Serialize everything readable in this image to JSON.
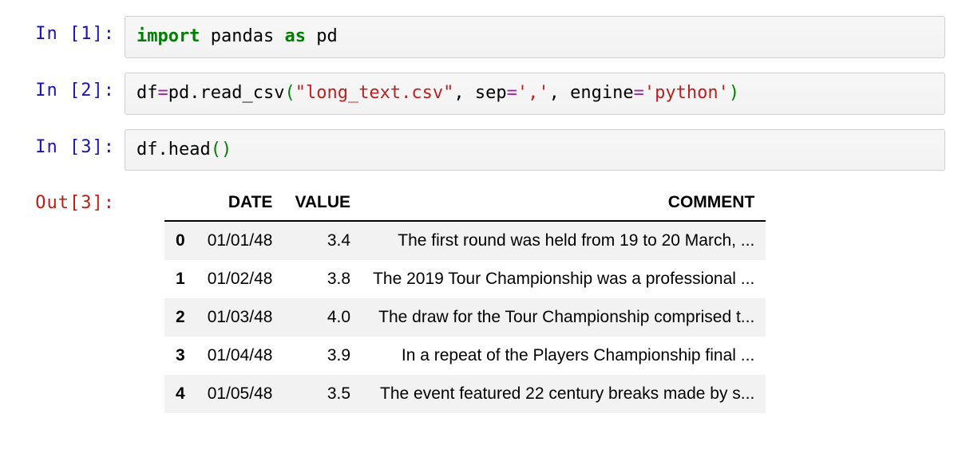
{
  "cells": [
    {
      "prompt": "In [1]:",
      "code_tokens": [
        {
          "t": "import",
          "c": "kw-green"
        },
        {
          "t": " pandas ",
          "c": ""
        },
        {
          "t": "as",
          "c": "kw-green"
        },
        {
          "t": " pd",
          "c": ""
        }
      ]
    },
    {
      "prompt": "In [2]:",
      "code_tokens": [
        {
          "t": "df",
          "c": ""
        },
        {
          "t": "=",
          "c": "op"
        },
        {
          "t": "pd",
          "c": ""
        },
        {
          "t": ".",
          "c": ""
        },
        {
          "t": "read_csv",
          "c": ""
        },
        {
          "t": "(",
          "c": "paren-green"
        },
        {
          "t": "\"long_text.csv\"",
          "c": "str"
        },
        {
          "t": ", sep",
          "c": ""
        },
        {
          "t": "=",
          "c": "op"
        },
        {
          "t": "','",
          "c": "str"
        },
        {
          "t": ", engine",
          "c": ""
        },
        {
          "t": "=",
          "c": "op"
        },
        {
          "t": "'python'",
          "c": "str"
        },
        {
          "t": ")",
          "c": "paren-green"
        }
      ]
    },
    {
      "prompt": "In [3]:",
      "code_tokens": [
        {
          "t": "df",
          "c": ""
        },
        {
          "t": ".",
          "c": ""
        },
        {
          "t": "head",
          "c": ""
        },
        {
          "t": "()",
          "c": "paren-green"
        }
      ]
    }
  ],
  "out_prompt": "Out[3]:",
  "table": {
    "columns": [
      "DATE",
      "VALUE",
      "COMMENT"
    ],
    "rows": [
      {
        "idx": "0",
        "date": "01/01/48",
        "value": "3.4",
        "comment": "The first round was held from 19 to 20 March, ..."
      },
      {
        "idx": "1",
        "date": "01/02/48",
        "value": "3.8",
        "comment": "The 2019 Tour Championship was a professional ..."
      },
      {
        "idx": "2",
        "date": "01/03/48",
        "value": "4.0",
        "comment": "The draw for the Tour Championship comprised t..."
      },
      {
        "idx": "3",
        "date": "01/04/48",
        "value": "3.9",
        "comment": "In a repeat of the Players Championship final ..."
      },
      {
        "idx": "4",
        "date": "01/05/48",
        "value": "3.5",
        "comment": "The event featured 22 century breaks made by s..."
      }
    ]
  }
}
